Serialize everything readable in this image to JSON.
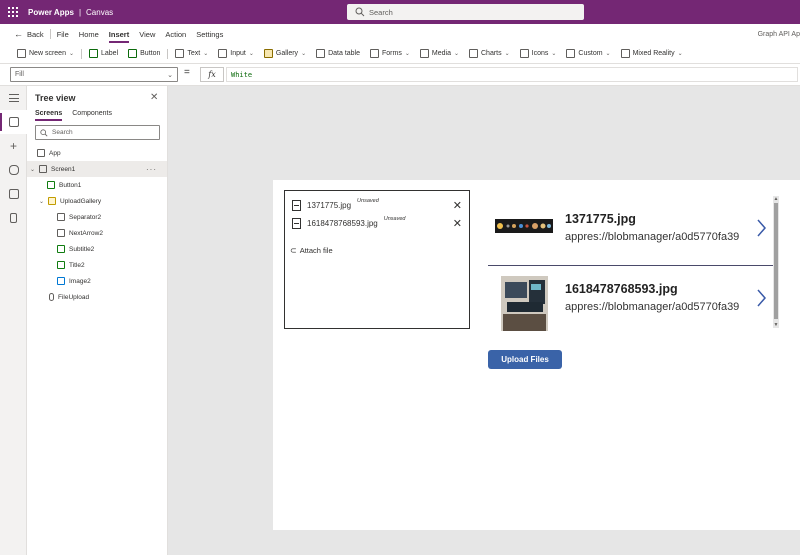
{
  "topbar": {
    "app_name": "Power Apps",
    "separator": "|",
    "mode": "Canvas",
    "search_placeholder": "Search"
  },
  "menu": {
    "back": "Back",
    "items": [
      "File",
      "Home",
      "Insert",
      "View",
      "Action",
      "Settings"
    ],
    "active": "Insert",
    "right_label": "Graph API Ap"
  },
  "ribbon": {
    "new_screen": "New screen",
    "label": "Label",
    "button": "Button",
    "text": "Text",
    "input": "Input",
    "gallery": "Gallery",
    "data_table": "Data table",
    "forms": "Forms",
    "media": "Media",
    "charts": "Charts",
    "icons": "Icons",
    "custom": "Custom",
    "mixed_reality": "Mixed Reality"
  },
  "formula": {
    "property": "Fill",
    "equals": "=",
    "fx": "fx",
    "value": "White"
  },
  "tree": {
    "title": "Tree view",
    "tabs": [
      "Screens",
      "Components"
    ],
    "active_tab": "Screens",
    "search_placeholder": "Search",
    "nodes": {
      "app": "App",
      "screen1": "Screen1",
      "button1": "Button1",
      "upload_gallery": "UploadGallery",
      "separator2": "Separator2",
      "next_arrow2": "NextArrow2",
      "subtitle2": "Subtitle2",
      "title2": "Title2",
      "image2": "Image2",
      "file_upload": "FileUpload"
    },
    "more": "···"
  },
  "attachments": {
    "files": [
      {
        "name": "1371775.jpg",
        "status": "Unsaved"
      },
      {
        "name": "1618478768593.jpg",
        "status": "Unsaved"
      }
    ],
    "attach_label": "Attach file"
  },
  "gallery": {
    "items": [
      {
        "title": "1371775.jpg",
        "subtitle": "appres://blobmanager/a0d5770fa39"
      },
      {
        "title": "1618478768593.jpg",
        "subtitle": "appres://blobmanager/a0d5770fa39"
      }
    ]
  },
  "upload_button": "Upload Files",
  "colors": {
    "brand": "#742774",
    "upload_button": "#3a63a8",
    "formula_text": "#0b6a0b"
  }
}
